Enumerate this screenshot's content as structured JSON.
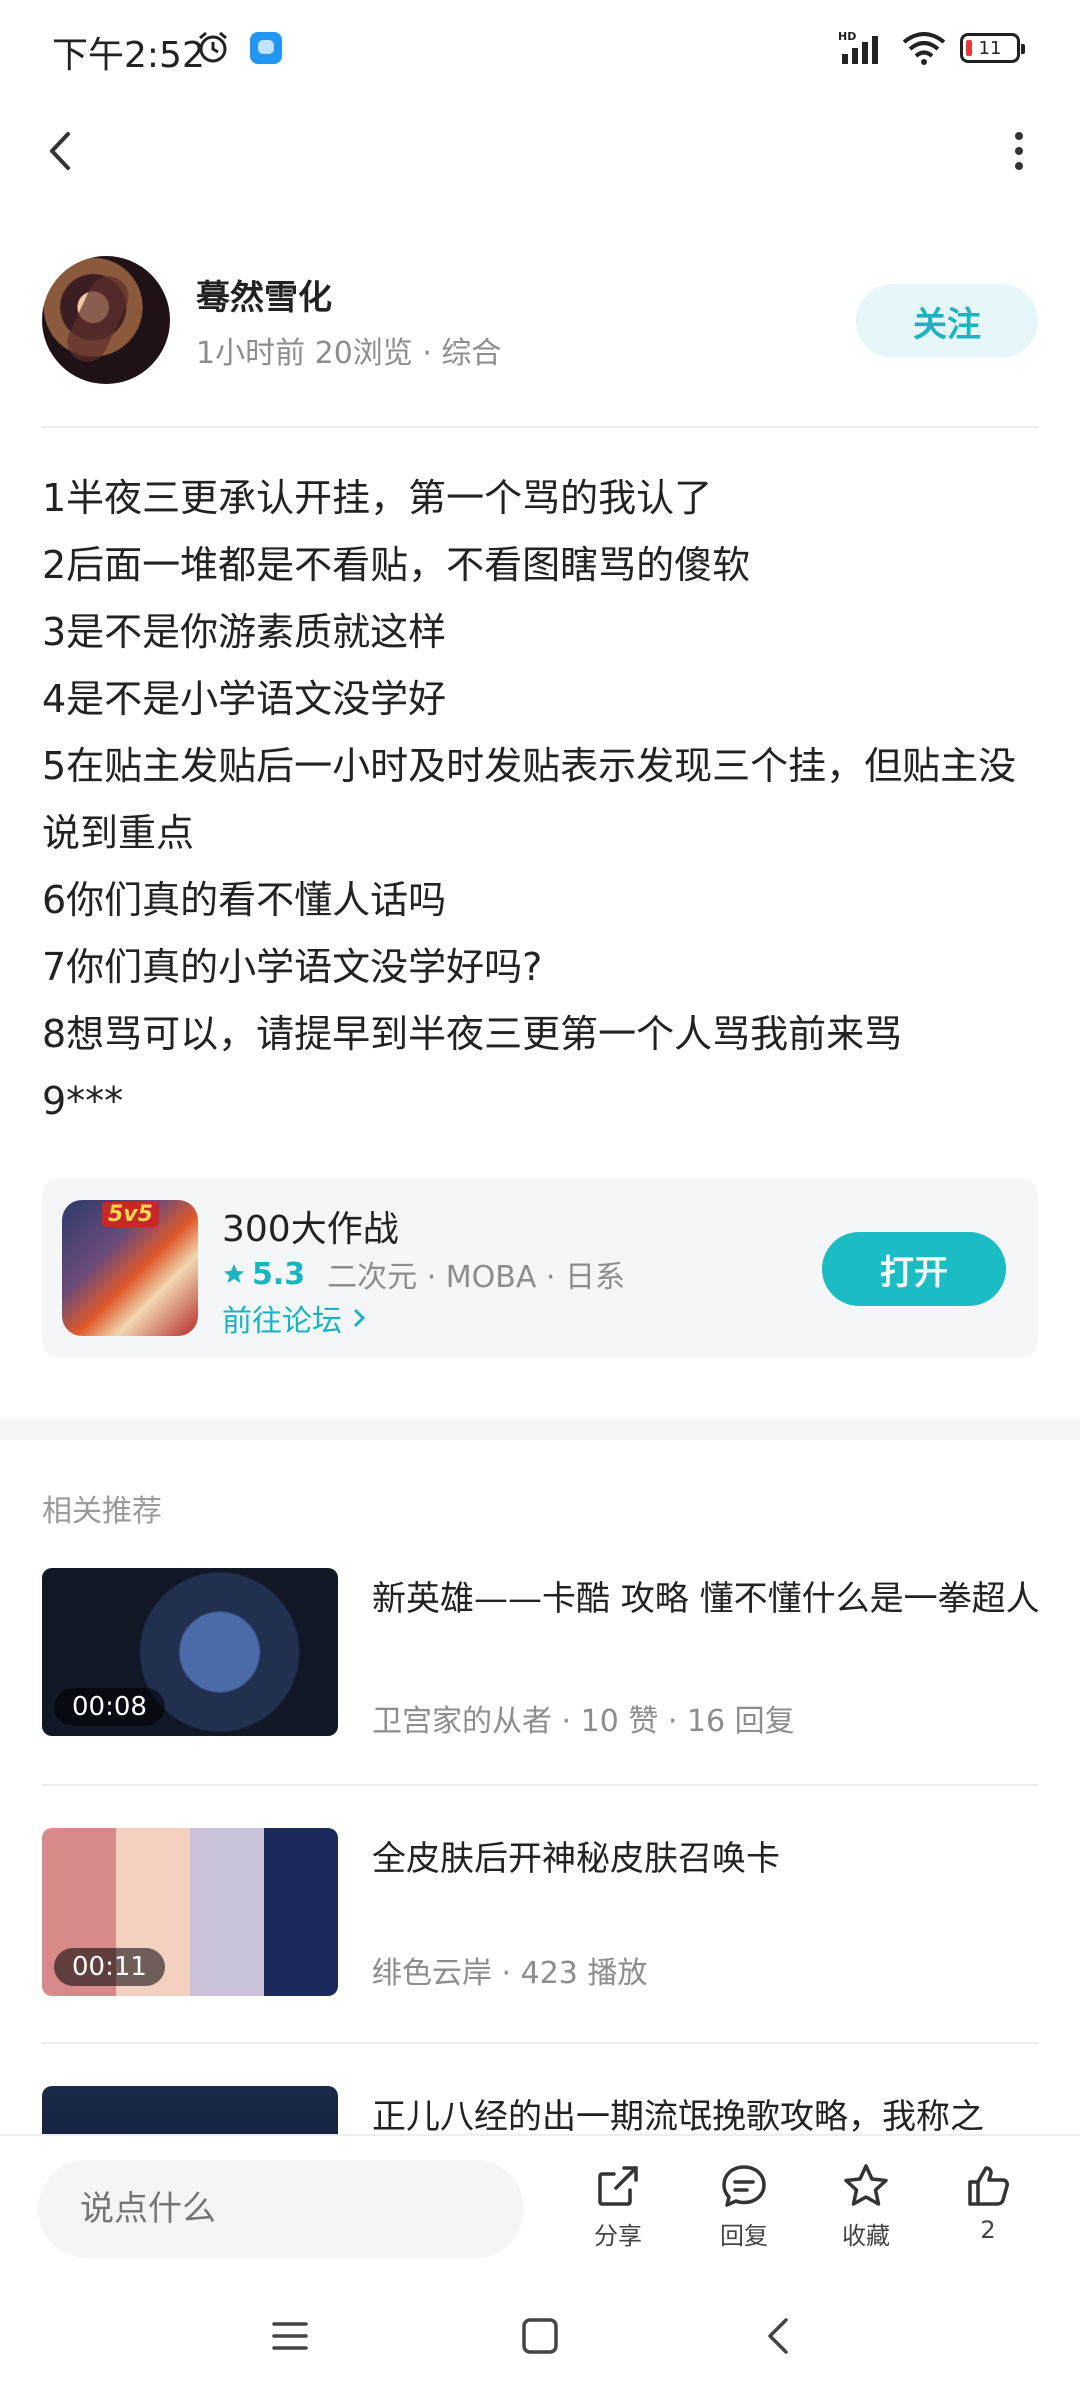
{
  "status_bar": {
    "time": "下午2:52",
    "network": "HD",
    "battery": "11"
  },
  "post": {
    "author": "蓦然雪化",
    "meta": "1小时前  20浏览  ·  综合",
    "follow_label": "关注",
    "lines": [
      "1半夜三更承认开挂，第一个骂的我认了",
      "2后面一堆都是不看贴，不看图瞎骂的傻软",
      "3是不是你游素质就这样",
      "4是不是小学语文没学好",
      "5在贴主发贴后一小时及时发贴表示发现三个挂，但贴主没说到重点",
      "6你们真的看不懂人话吗",
      "7你们真的小学语文没学好吗?",
      "8想骂可以，请提早到半夜三更第一个人骂我前来骂",
      "9***"
    ]
  },
  "game_card": {
    "badge": "5v5",
    "title": "300大作战",
    "rating": "5.3",
    "tags": "二次元  ·  MOBA  ·  日系",
    "forum_link": "前往论坛",
    "open_label": "打开"
  },
  "recommendations": {
    "title": "相关推荐",
    "items": [
      {
        "title": "新英雄——卡酷 攻略 懂不懂什么是一拳超人",
        "sub": "卫宫家的从者  ·  10 赞  ·  16 回复",
        "duration": "00:08"
      },
      {
        "title": "全皮肤后开神秘皮肤召唤卡",
        "sub": "绯色云岸  ·  423 播放",
        "duration": "00:11"
      },
      {
        "title": "正儿八经的出一期流氓挽歌攻略，我称之",
        "sub": "",
        "duration": ""
      }
    ]
  },
  "bottom_bar": {
    "comment_placeholder": "说点什么",
    "share_label": "分享",
    "reply_label": "回复",
    "favorite_label": "收藏",
    "like_count": "2"
  },
  "colors": {
    "accent": "#1cbcc4",
    "text": "#222222",
    "secondary": "#8d8d8d"
  }
}
